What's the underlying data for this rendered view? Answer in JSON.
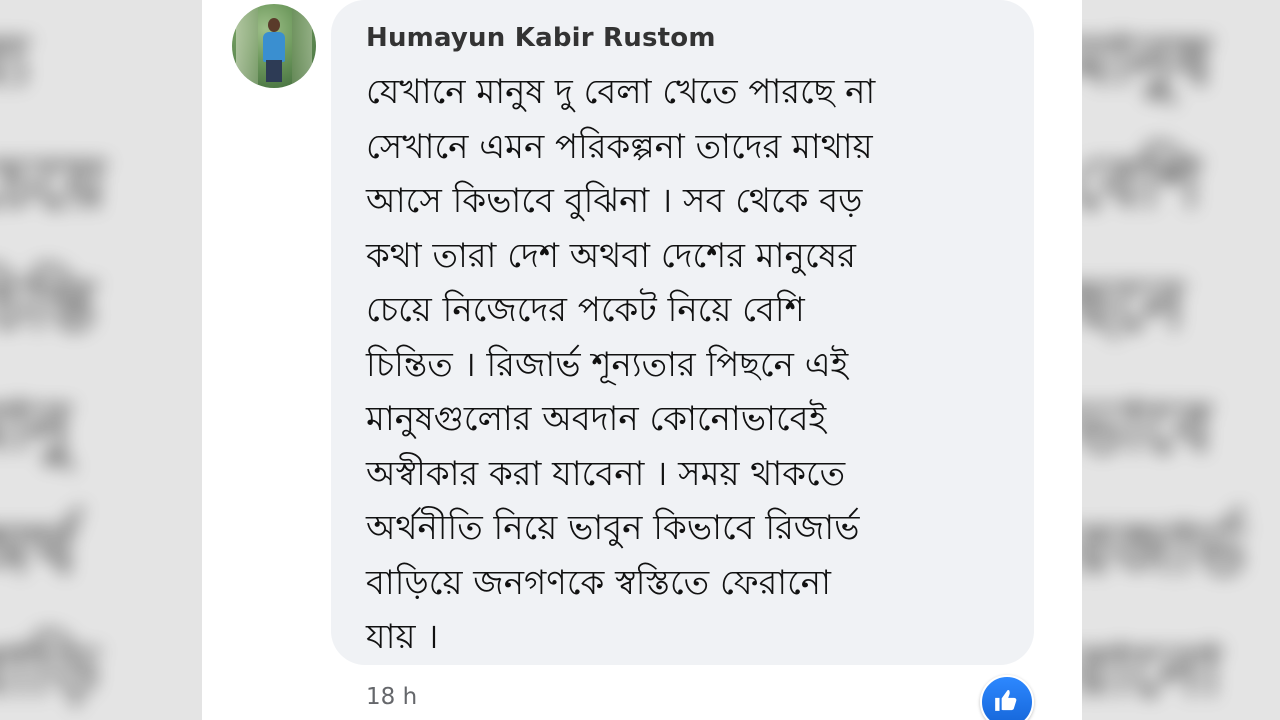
{
  "comment": {
    "author": "Humayun Kabir Rustom",
    "text": "যেখানে মানুষ দু বেলা খেতে পারছে না\nসেখানে এমন পরিকল্পনা তাদের মাথায়\nআসে কিভাবে বুঝিনা । সব থেকে বড়\nকথা তারা দেশ অথবা দেশের মানুষের\nচেয়ে নিজেদের পকেট নিয়ে বেশি\nচিন্তিত । রিজার্ভ শূন্যতার পিছনে এই\nমানুষগুলোর অবদান কোনোভাবেই\nঅস্বীকার করা যাবেনা । সময় থাকতে\nঅর্থনীতি নিয়ে ভাবুন কিভাবে রিজার্ভ\nবাড়িয়ে জনগণকে স্বস্তিতে ফেরানো\nযায় ।",
    "timestamp": "18 h",
    "reaction_icon": "like-icon"
  },
  "colors": {
    "bubble": "#f0f2f5",
    "reaction": "#1877f2",
    "timestamp": "#65676b"
  }
}
